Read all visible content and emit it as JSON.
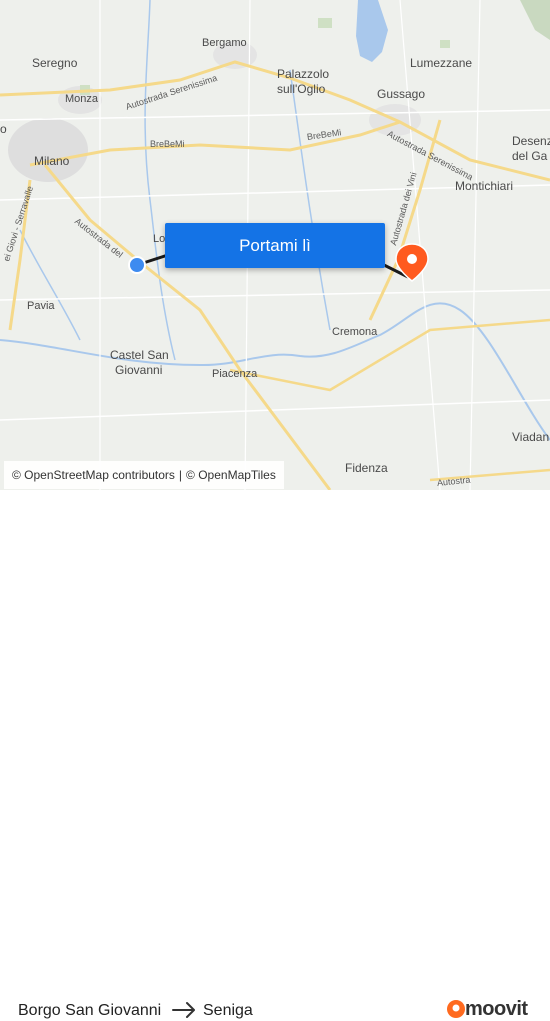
{
  "map": {
    "places": {
      "seregno": "Seregno",
      "bergamo": "Bergamo",
      "palazzolo_1": "Palazzolo",
      "palazzolo_2": "sull'Oglio",
      "lumezzane": "Lumezzane",
      "monza": "Monza",
      "gussago": "Gussago",
      "desenzano_1": "Desenz",
      "desenzano_2": "del Ga",
      "milano": "Milano",
      "montichiari": "Montichiari",
      "lodi": "Lo",
      "pavia": "Pavia",
      "cremona": "Cremona",
      "castel_1": "Castel San",
      "castel_2": "Giovanni",
      "piacenza": "Piacenza",
      "viadana": "Viadan",
      "fidenza": "Fidenza",
      "left_o": "o"
    },
    "roads": {
      "serenissima_1": "Autostrada Serenissima",
      "serenissima_2": "Autostrada Serenissima",
      "brebemi_1": "BreBeMi",
      "brebemi_2": "BreBeMi",
      "vini": "Autostrada dei Vini",
      "del_sole": "Autostrada del",
      "serravalle": "ei Giovi - Serravalle",
      "bottom": "Autostra"
    },
    "colors": {
      "route": "#1a1a1a",
      "origin": "#3d8bf0",
      "destination": "#ff5a1f",
      "water": "#a9c8ec",
      "motorway": "#f5d98a",
      "urban": "#dcdcdc"
    }
  },
  "cta": {
    "label": "Portami lì"
  },
  "attribution": {
    "osm": "© OpenStreetMap contributors",
    "sep": "|",
    "omt": "© OpenMapTiles"
  },
  "footer": {
    "from": "Borgo San Giovanni",
    "to": "Seniga",
    "logo": "moovit"
  }
}
